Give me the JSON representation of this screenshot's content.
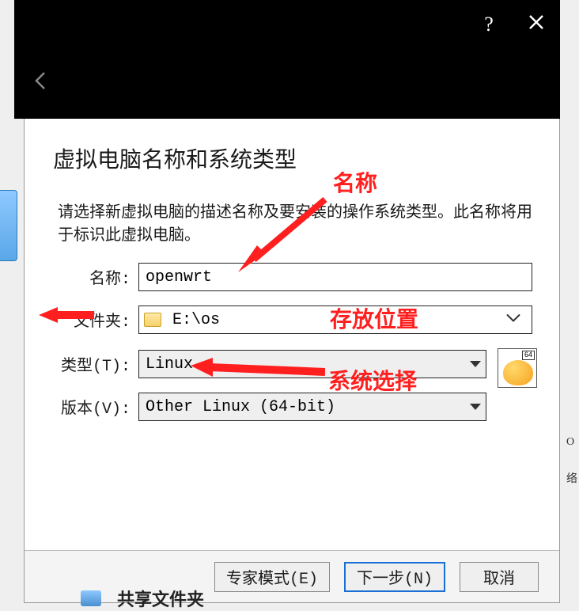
{
  "dialog": {
    "title": "虚拟电脑名称和系统类型",
    "description": "请选择新虚拟电脑的描述名称及要安装的操作系统类型。此名称将用于标识此虚拟电脑。",
    "labels": {
      "name": "名称:",
      "folder": "文件夹:",
      "type": "类型(T):",
      "version": "版本(V):"
    },
    "values": {
      "name": "openwrt",
      "folder": "E:\\os",
      "type": "Linux",
      "version": "Other Linux (64-bit)"
    },
    "os_badge": "64",
    "buttons": {
      "expert": "专家模式(E)",
      "next": "下一步(N)",
      "cancel": "取消"
    }
  },
  "annotations": {
    "name": "名称",
    "folder": "存放位置",
    "type": "系统选择"
  },
  "background": {
    "bottom_text": "共享文件夹"
  }
}
